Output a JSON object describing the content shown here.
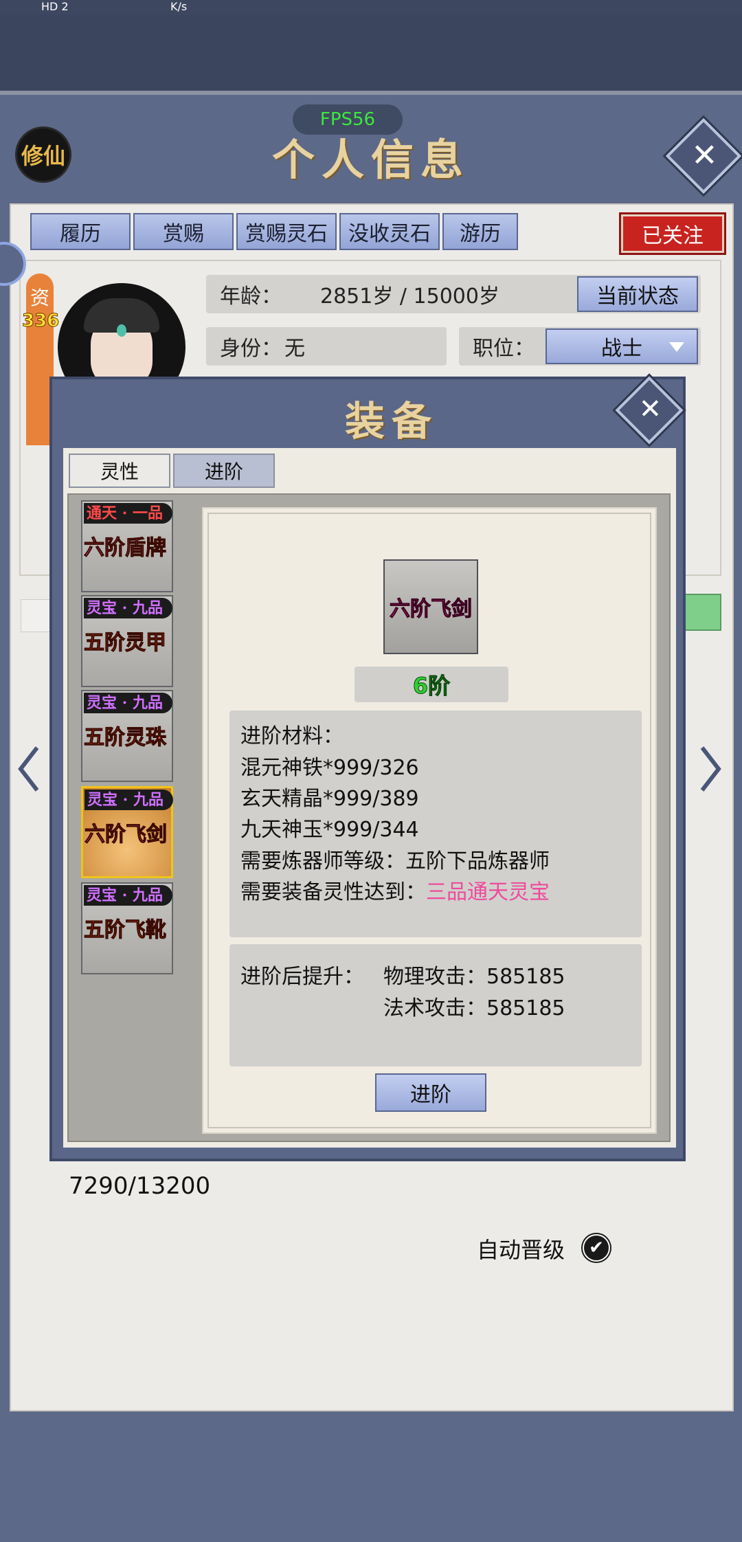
{
  "status_bar": {
    "left": "HD 2",
    "speed": "K/s"
  },
  "header": {
    "badge": "修仙",
    "fps": "FPS56",
    "title": "个人信息"
  },
  "tabs": [
    "履历",
    "赏赐",
    "赏赐灵石",
    "没收灵石",
    "游历"
  ],
  "follow_label": "已关注",
  "profile": {
    "zi_label": "资",
    "zi_value": "336",
    "age_label": "年龄：",
    "age_value": "2851岁 / 15000岁",
    "status_button": "当前状态",
    "identity_label": "身份：",
    "identity_value": "无",
    "position_label": "职位：",
    "position_value": "战士"
  },
  "equipment_dialog": {
    "title": "装备",
    "tabs": [
      "灵性",
      "进阶"
    ],
    "items": [
      {
        "grade": "通天 · 一品",
        "name": "六阶盾牌",
        "grade_color": "#ff4a4a",
        "name_color": "#ff4fa0"
      },
      {
        "grade": "灵宝 · 九品",
        "name": "五阶灵甲",
        "grade_color": "#d070ff",
        "name_color": "#ff5a2c"
      },
      {
        "grade": "灵宝 · 九品",
        "name": "五阶灵珠",
        "grade_color": "#d070ff",
        "name_color": "#ff5a2c"
      },
      {
        "grade": "灵宝 · 九品",
        "name": "六阶飞剑",
        "grade_color": "#d070ff",
        "name_color": "#ff3c8c"
      },
      {
        "grade": "灵宝 · 九品",
        "name": "五阶飞靴",
        "grade_color": "#d070ff",
        "name_color": "#ff5a2c"
      }
    ],
    "selected_name": "六阶飞剑",
    "level": "6阶",
    "materials_title": "进阶材料：",
    "materials": [
      "混元神铁*999/326",
      "玄天精晶*999/389",
      "九天神玉*999/344"
    ],
    "req_refiner": "需要炼器师等级：五阶下品炼器师",
    "req_spirit_label": "需要装备灵性达到：",
    "req_spirit_value": "三品通天灵宝",
    "boost_label": "进阶后提升：",
    "boost_phys": "物理攻击：585185",
    "boost_magic": "法术攻击：585185",
    "advance_button": "进阶"
  },
  "progress_text": "7290/13200",
  "auto_promote_label": "自动晋级",
  "colors": {
    "accent_blue": "#99a9da",
    "follow_red": "#c8231e",
    "spirit_pink": "#ee4a9c"
  }
}
